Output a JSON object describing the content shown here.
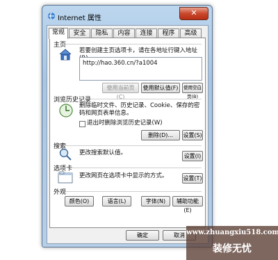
{
  "window": {
    "title": "Internet 属性",
    "close": "✕"
  },
  "tabs": [
    "常规",
    "安全",
    "隐私",
    "内容",
    "连接",
    "程序",
    "高级"
  ],
  "home": {
    "section": "主页",
    "description": "若要创建主页选项卡，请在各地址行键入地址(R)。",
    "url": "http://hao.360.cn/?a1004",
    "buttons": [
      "使用当前页(C)",
      "使用默认值(F)",
      "使用空白页(B)"
    ]
  },
  "history": {
    "section": "浏览历史记录",
    "description": "删除临时文件、历史记录、Cookie、保存的密码和网页表单信息。",
    "checkbox": "退出时删除浏览历史记录(W)",
    "buttons": [
      "删除(D)...",
      "设置(S)"
    ]
  },
  "search": {
    "section": "搜索",
    "description": "更改搜索默认值。",
    "button": "设置(I)"
  },
  "tabs_section": {
    "section": "选项卡",
    "description": "更改网页在选项卡中显示的方式。",
    "button": "设置(T)"
  },
  "appearance": {
    "section": "外观",
    "buttons": [
      "颜色(O)",
      "语言(L)",
      "字体(N)",
      "辅助功能(E)"
    ]
  },
  "dialog_buttons": [
    "确定",
    "取消"
  ],
  "watermark": {
    "url": "www.zhuangxiu518.com",
    "name": "装修无忧"
  },
  "colors": {
    "title_bar": "#bcd6ee",
    "close_button": "#c9482d",
    "panel": "#ffffff"
  }
}
